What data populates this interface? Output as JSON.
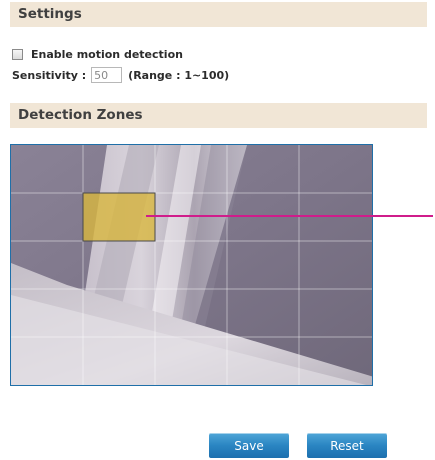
{
  "settings": {
    "header": "Settings",
    "enable_motion_label": "Enable motion detection",
    "enable_motion_checked": false,
    "sensitivity_label": "Sensitivity :",
    "sensitivity_value": "50",
    "sensitivity_range": "(Range : 1~100)"
  },
  "zones": {
    "header": "Detection Zones",
    "grid_columns": 5,
    "grid_rows": 5,
    "selected_zone": {
      "row": 2,
      "column": 2
    },
    "zone_highlight_color": "#d8b63e",
    "pointer_line_color": "#d01c8b"
  },
  "buttons": {
    "save_label": "Save",
    "reset_label": "Reset",
    "button_color": "#2a85c2"
  }
}
